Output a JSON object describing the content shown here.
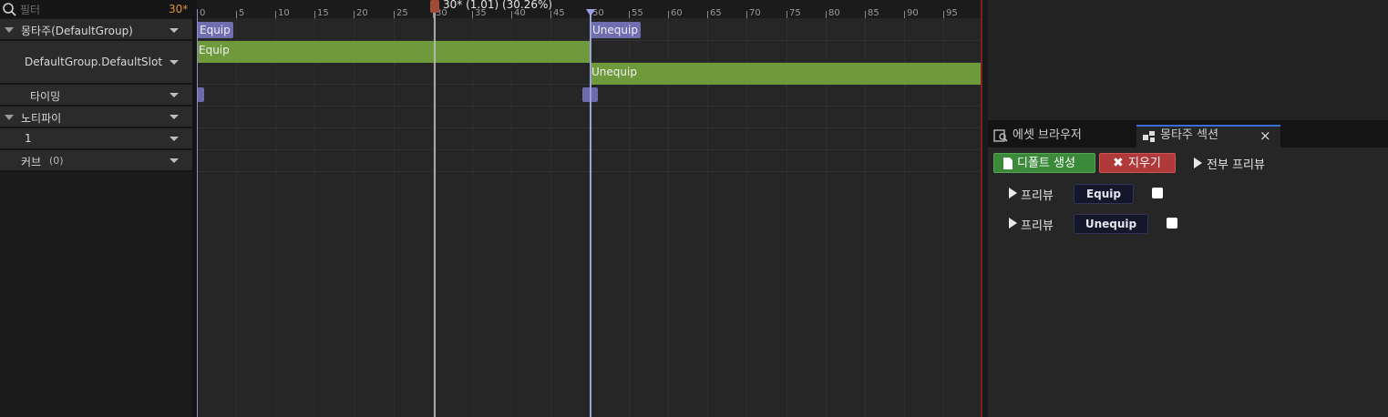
{
  "filter": {
    "placeholder": "필터",
    "fps": "30*"
  },
  "tracks": {
    "montage_group": "몽타주(DefaultGroup)",
    "slot": "DefaultGroup.DefaultSlot",
    "timing": "타이밍",
    "notify": "노티파이",
    "notify_track": "1",
    "curves": "커브",
    "curves_count": "(0)"
  },
  "ruler": {
    "ticks": [
      "0",
      "5",
      "10",
      "15",
      "20",
      "25",
      "30",
      "35",
      "40",
      "45",
      "50",
      "55",
      "60",
      "65",
      "70",
      "75",
      "80",
      "85",
      "90",
      "95"
    ],
    "scrub_label": "30* (1.01) (30.26%)"
  },
  "timeline": {
    "sections": [
      "Equip",
      "Unequip"
    ],
    "segments": [
      "Equip",
      "Unequip"
    ]
  },
  "tabs": {
    "asset_browser": "에셋 브라우저",
    "montage_sections": "몽타주 섹션",
    "close": "×"
  },
  "sections_panel": {
    "create_default": "디폴트 생성",
    "clear": "지우기",
    "preview_all": "전부 프리뷰",
    "preview_label": "프리뷰",
    "rows": [
      {
        "name": "Equip"
      },
      {
        "name": "Unequip"
      }
    ]
  },
  "colors": {
    "segment_green": "#6e9a3c",
    "section_purple": "#6f6fb0",
    "fps_orange": "#e0913a",
    "tab_accent": "#3b6dd6"
  }
}
